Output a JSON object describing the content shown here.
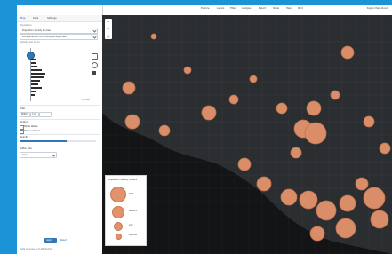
{
  "app": {
    "title": "Locator - Risk Map",
    "tabs": [
      "Map",
      "Data",
      "Settings"
    ]
  },
  "panel": {
    "section_title": "Population",
    "select_1": "Population density by area",
    "select_2": "2019 American Community Survey 5-Year",
    "measure_label": "Density per sq mi",
    "range_min": "0",
    "range_max": "48,000",
    "filters_label": "Filter",
    "filter_chip_1": "Within",
    "filter_chip_2": "3 mi",
    "options_label": "Options",
    "check_label_1": "Show labels",
    "check_label_2": "Show outlines",
    "opacity_label": "Opacity",
    "opacity_value": 0.62,
    "buffer_label": "Buffer size",
    "apply_button": "Apply",
    "reset_link": "Reset",
    "footer_text": "Data sources and attribution"
  },
  "header_links": [
    "Explore",
    "Layers",
    "Filter",
    "Analysis",
    "Export",
    "Share",
    "Help",
    "Print"
  ],
  "header_right": "Sign in   Help   About",
  "legend": {
    "title": "Population density clusters",
    "items": [
      {
        "label": "High"
      },
      {
        "label": "Medium"
      },
      {
        "label": "Low"
      },
      {
        "label": "Minimal"
      }
    ]
  },
  "colors": {
    "accent": "#2f78b7",
    "cluster_fill": "#e3936b",
    "cluster_stroke": "#c6764f",
    "map_land": "#2b2e31",
    "water": "#111"
  },
  "icons": {
    "zoom_in": "plus-icon",
    "zoom_out": "minus-icon"
  }
}
